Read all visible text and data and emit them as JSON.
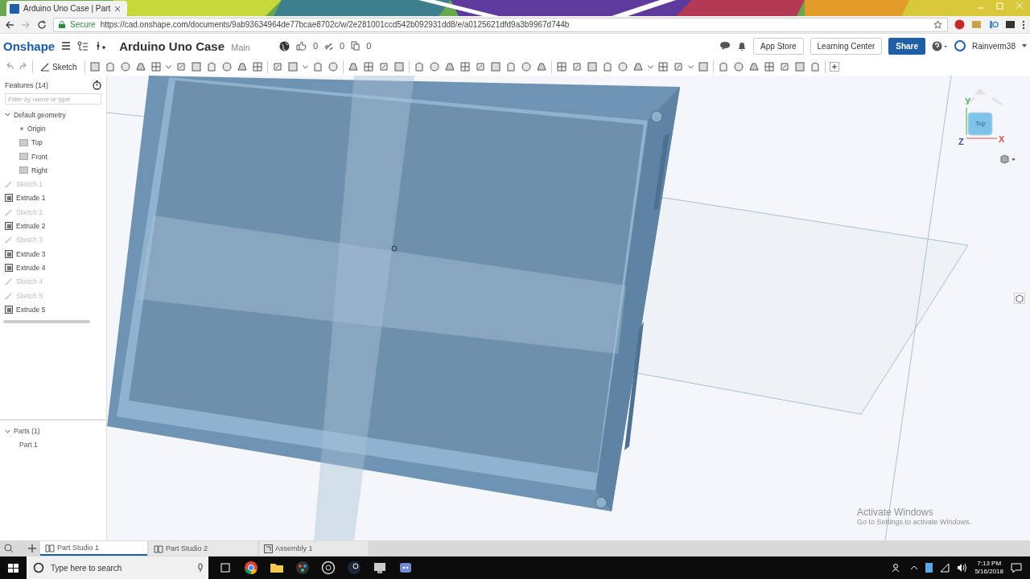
{
  "browser": {
    "tab_title": "Arduino Uno Case | Part",
    "secure": "Secure",
    "url": "https://cad.onshape.com/documents/9ab93634964de77bcae8702c/w/2e281001ccd542b092931dd8/e/a0125621dfd9a3b9967d744b"
  },
  "app": {
    "logo": "Onshape",
    "document_title": "Arduino Uno Case",
    "workspace": "Main",
    "likes": "0",
    "links": "0",
    "copies": "0",
    "buttons": [
      "App Store",
      "Learning Center"
    ],
    "share": "Share",
    "user": "Rainverm38"
  },
  "toolbar": {
    "sketch": "Sketch"
  },
  "features": {
    "title": "Features (14)",
    "filter_placeholder": "Filter by name or type",
    "tree": [
      {
        "label": "Default geometry",
        "kind": "group",
        "expanded": true,
        "children": [
          {
            "label": "Origin",
            "kind": "origin"
          },
          {
            "label": "Top",
            "kind": "plane"
          },
          {
            "label": "Front",
            "kind": "plane"
          },
          {
            "label": "Right",
            "kind": "plane"
          }
        ]
      },
      {
        "label": "Sketch 1",
        "kind": "sketch"
      },
      {
        "label": "Extrude 1",
        "kind": "extrude"
      },
      {
        "label": "Sketch 2",
        "kind": "sketch"
      },
      {
        "label": "Extrude 2",
        "kind": "extrude"
      },
      {
        "label": "Sketch 3",
        "kind": "sketch"
      },
      {
        "label": "Extrude 3",
        "kind": "extrude"
      },
      {
        "label": "Extrude 4",
        "kind": "extrude"
      },
      {
        "label": "Sketch 4",
        "kind": "sketch"
      },
      {
        "label": "Sketch 5",
        "kind": "sketch"
      },
      {
        "label": "Extrude 5",
        "kind": "extrude"
      }
    ]
  },
  "parts": {
    "title": "Parts (1)",
    "expanded": true,
    "items": [
      "Part 1"
    ]
  },
  "view_cube": {
    "face": "Top",
    "axes": [
      {
        "label": "Y",
        "color": "#4caf50"
      },
      {
        "label": "Z",
        "color": "#3a4fa8"
      },
      {
        "label": "X",
        "color": "#d9534f"
      }
    ]
  },
  "notice": {
    "title": "Activate Windows",
    "text": "Go to Settings to activate Windows."
  },
  "tabs": [
    {
      "label": "Part Studio 1",
      "kind": "part_studio",
      "selected": true
    },
    {
      "label": "Part Studio 2",
      "kind": "part_studio",
      "selected": false
    },
    {
      "label": "Assembly 1",
      "kind": "assembly",
      "selected": false
    }
  ],
  "taskbar": {
    "search_placeholder": "Type here to search",
    "time": "7:13 PM",
    "date": "5/16/2018"
  }
}
